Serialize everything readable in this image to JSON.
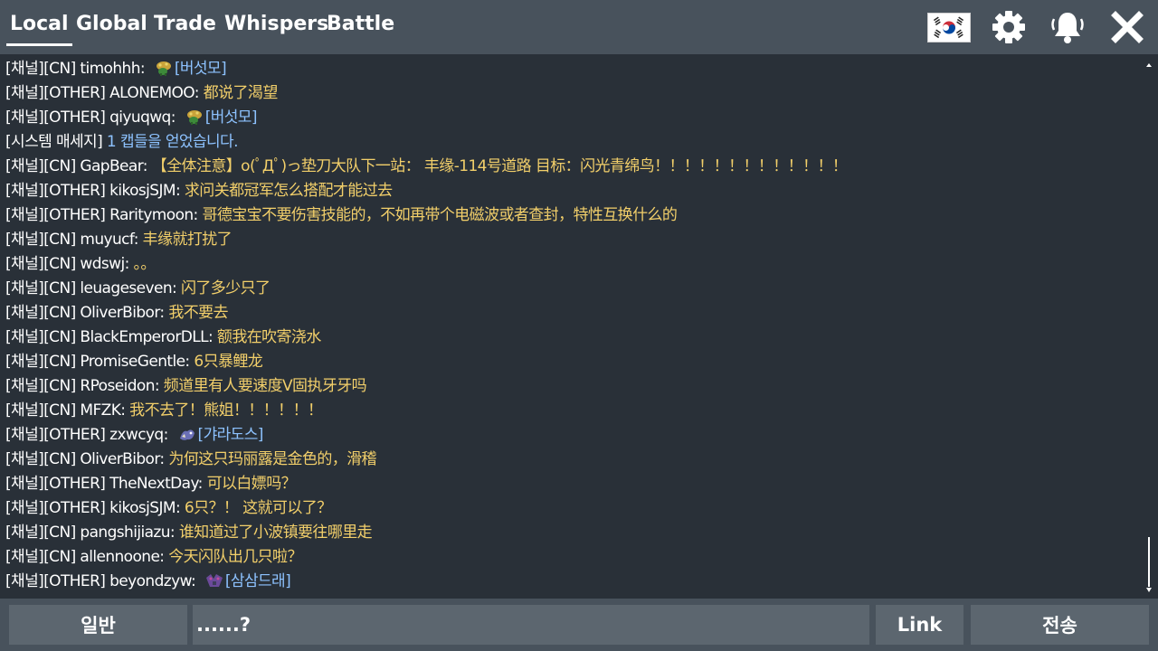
{
  "tabs": [
    {
      "label": "Local",
      "active": true
    },
    {
      "label": "Global"
    },
    {
      "label": "Trade"
    },
    {
      "label": "Whispers"
    },
    {
      "label": "Battle"
    }
  ],
  "toolbar": {
    "flag_icon": "korea-flag-icon",
    "settings_icon": "gear-icon",
    "notifications_icon": "bell-icon",
    "close_icon": "close-icon"
  },
  "colors": {
    "header_bg": "#48525c",
    "chat_bg": "#293038",
    "message_text": "#f2cf6a",
    "item_link": "#8dc2ff",
    "sender_text": "#ffffff"
  },
  "chat": {
    "messages": [
      {
        "prefix": "[채널][CN] timohhh: ",
        "text": "",
        "item": "[버섯모]",
        "item_icon": "paras-icon"
      },
      {
        "prefix": "[채널][OTHER] ALONEMOO: ",
        "text": "都说了渴望"
      },
      {
        "prefix": "[채널][OTHER] qiyuqwq: ",
        "text": "",
        "item": "[버섯모]",
        "item_icon": "paras-icon"
      },
      {
        "prefix": "[시스템 매세지] ",
        "text": "1 캡들을 얻었습니다.",
        "system": true
      },
      {
        "prefix": "[채널][CN] GapBear: ",
        "text": "【全体注意】o(ﾟДﾟ)っ垫刀大队下一站：  丰缘-114号道路 目标：闪光青绵鸟！！！！！！！！！！！！！"
      },
      {
        "prefix": "[채널][OTHER] kikosjSJM: ",
        "text": "求问关都冠军怎么搭配才能过去"
      },
      {
        "prefix": "[채널][OTHER] Raritymoon: ",
        "text": "哥德宝宝不要伤害技能的，不如再带个电磁波或者查封，特性互换什么的"
      },
      {
        "prefix": "[채널][CN] muyucf: ",
        "text": "丰缘就打扰了"
      },
      {
        "prefix": "[채널][CN] wdswj: ",
        "text": "。。"
      },
      {
        "prefix": "[채널][CN] leuageseven: ",
        "text": "闪了多少只了"
      },
      {
        "prefix": "[채널][CN] OliverBibor: ",
        "text": "我不要去"
      },
      {
        "prefix": "[채널][CN] BlackEmperorDLL: ",
        "text": "额我在吹寄浇水"
      },
      {
        "prefix": "[채널][CN] PromiseGentle: ",
        "text": "6只暴鲤龙"
      },
      {
        "prefix": "[채널][CN] RPoseidon: ",
        "text": "频道里有人要速度V固执牙牙吗"
      },
      {
        "prefix": "[채널][CN] MFZK: ",
        "text": "我不去了！熊姐！！！！！！"
      },
      {
        "prefix": "[채널][OTHER] zxwcyq: ",
        "text": "",
        "item": "[갸라도스]",
        "item_icon": "gyarados-icon"
      },
      {
        "prefix": "[채널][CN] OliverBibor: ",
        "text": "为何这只玛丽露是金色的，滑稽"
      },
      {
        "prefix": "[채널][OTHER] TheNextDay: ",
        "text": "可以白嫖吗？"
      },
      {
        "prefix": "[채널][OTHER] kikosjSJM: ",
        "text": "6只？！ 这就可以了？"
      },
      {
        "prefix": "[채널][CN] pangshijiazu: ",
        "text": "谁知道过了小波镇要往哪里走"
      },
      {
        "prefix": "[채널][CN] allennoone: ",
        "text": "今天闪队出几只啦？"
      },
      {
        "prefix": "[채널][OTHER] beyondzyw: ",
        "text": "",
        "item": "[삼삼드래]",
        "item_icon": "hydreigon-icon"
      }
    ]
  },
  "input_bar": {
    "channel_label": "일반",
    "input_value": "......?",
    "link_label": "Link",
    "send_label": "전송"
  }
}
